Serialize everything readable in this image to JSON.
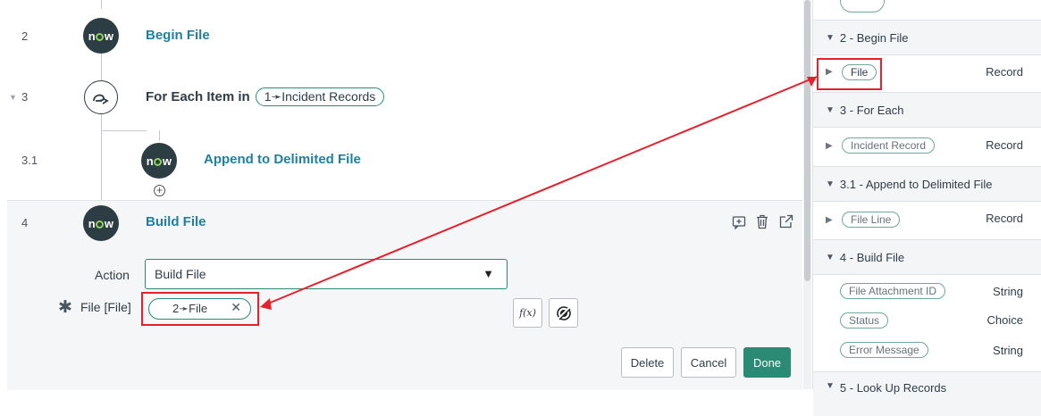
{
  "steps": [
    {
      "number": "2",
      "title": "Begin File"
    },
    {
      "number": "3",
      "title_prefix": "For Each Item in",
      "pill": "1➛Incident Records"
    },
    {
      "number": "3.1",
      "title": "Append to Delimited File"
    },
    {
      "number": "4",
      "title": "Build File"
    }
  ],
  "logo_text": {
    "n": "n",
    "w": "w"
  },
  "editor": {
    "action_label": "Action",
    "action_value": "Build File",
    "file_label": "File [File]",
    "file_pill": "2➛File",
    "fx_label": "f(x)",
    "buttons": {
      "delete": "Delete",
      "cancel": "Cancel",
      "done": "Done"
    }
  },
  "data_panel": {
    "sections": [
      {
        "header": "2 - Begin File",
        "items": [
          {
            "pill": "File",
            "type": "Record"
          }
        ]
      },
      {
        "header": "3 - For Each",
        "items": [
          {
            "pill": "Incident Record",
            "type": "Record"
          }
        ]
      },
      {
        "header": "3.1 - Append to Delimited File",
        "items": [
          {
            "pill": "File Line",
            "type": "Record"
          }
        ]
      },
      {
        "header": "4 - Build File",
        "items": [
          {
            "pill": "File Attachment ID",
            "type": "String"
          },
          {
            "pill": "Status",
            "type": "Choice"
          },
          {
            "pill": "Error Message",
            "type": "String"
          }
        ]
      },
      {
        "header": "5 - Look Up Records"
      }
    ]
  },
  "colors": {
    "accent": "#2a8a74",
    "link": "#1f7fa1",
    "annotation": "#e4212d"
  }
}
